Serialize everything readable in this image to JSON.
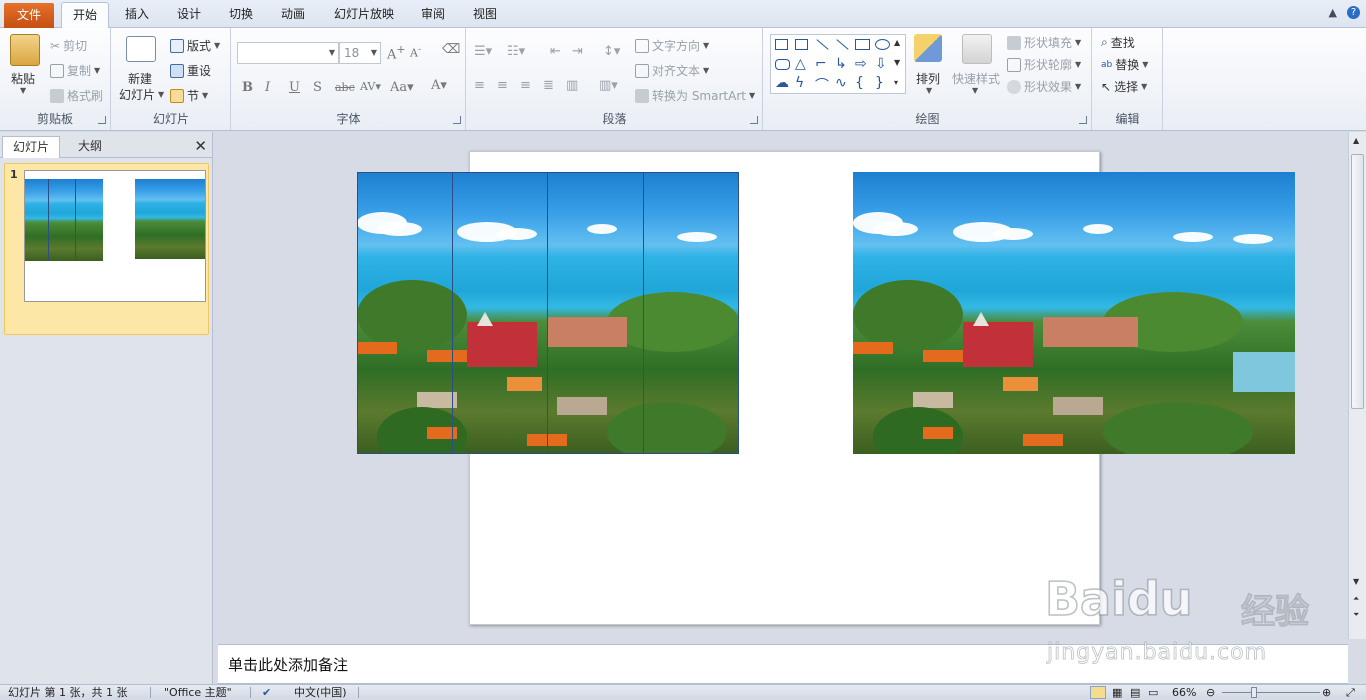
{
  "tabs": {
    "file": "文件",
    "home": "开始",
    "insert": "插入",
    "design": "设计",
    "transitions": "切换",
    "animations": "动画",
    "slideshow": "幻灯片放映",
    "review": "审阅",
    "view": "视图"
  },
  "ribbon": {
    "clipboard": {
      "paste": "粘贴",
      "cut": "剪切",
      "copy": "复制",
      "format_painter": "格式刷",
      "label": "剪贴板"
    },
    "slides": {
      "new_slide_line1": "新建",
      "new_slide_line2": "幻灯片",
      "layout": "版式",
      "reset": "重设",
      "section": "节",
      "label": "幻灯片"
    },
    "font": {
      "font_name": "",
      "font_size": "18",
      "label": "字体"
    },
    "paragraph": {
      "text_direction": "文字方向",
      "align_text": "对齐文本",
      "convert_smartart": "转换为 SmartArt",
      "label": "段落"
    },
    "drawing": {
      "arrange": "排列",
      "quick_styles": "快速样式",
      "shape_fill": "形状填充",
      "shape_outline": "形状轮廓",
      "shape_effects": "形状效果",
      "label": "绘图"
    },
    "editing": {
      "find": "查找",
      "replace": "替换",
      "select": "选择",
      "label": "编辑"
    }
  },
  "left_panel": {
    "tab_slides": "幻灯片",
    "tab_outline": "大纲",
    "slide_number": "1"
  },
  "notes": {
    "placeholder": "单击此处添加备注"
  },
  "status": {
    "slide_info": "幻灯片 第 1 张，共 1 张",
    "theme": "\"Office 主题\"",
    "language": "中文(中国)",
    "zoom": "66%"
  },
  "watermark": {
    "logo": "Baidu",
    "brand_cn": "经验",
    "url": "jingyan.baidu.com"
  },
  "colors": {
    "file_tab": "#d9601e",
    "selection": "#2b4f84",
    "thumb_highlight": "#fde7a7"
  }
}
